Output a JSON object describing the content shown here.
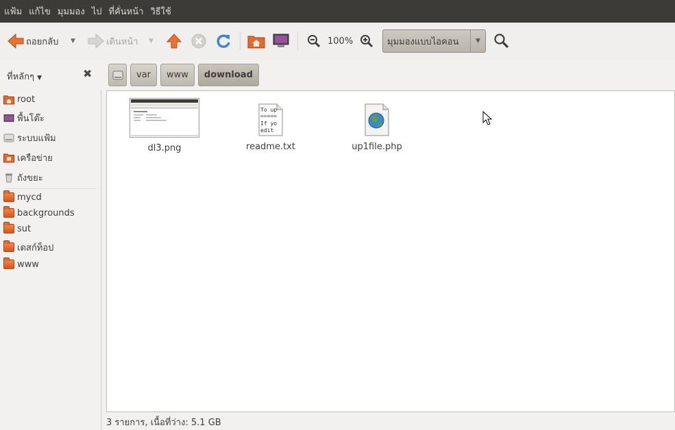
{
  "menubar": {
    "items": [
      "แฟ้ม",
      "แก้ไข",
      "มุมมอง",
      "ไป",
      "ที่คั่นหน้า",
      "วิธีใช้"
    ]
  },
  "toolbar": {
    "back_label": "ถอยกลับ",
    "forward_label": "เดินหน้า",
    "zoom_level": "100%",
    "view_mode": "มุมมองแบบไอคอน"
  },
  "sidebar": {
    "title": "ที่หลักๆ",
    "places": [
      {
        "label": "root",
        "icon": "home-folder-icon"
      },
      {
        "label": "พื้นโต๊ะ",
        "icon": "desktop-icon"
      },
      {
        "label": "ระบบแฟ้ม",
        "icon": "filesystem-drive-icon"
      },
      {
        "label": "เครือข่าย",
        "icon": "network-icon"
      },
      {
        "label": "ถังขยะ",
        "icon": "trash-icon"
      }
    ],
    "bookmarks": [
      {
        "label": "mycd",
        "icon": "folder-icon"
      },
      {
        "label": "backgrounds",
        "icon": "folder-icon"
      },
      {
        "label": "sut",
        "icon": "folder-icon"
      },
      {
        "label": "เดสก์ท็อป",
        "icon": "folder-icon"
      },
      {
        "label": "www",
        "icon": "folder-icon"
      }
    ]
  },
  "pathbar": {
    "crumbs": [
      "var",
      "www",
      "download"
    ]
  },
  "files": [
    {
      "name": "dl3.png",
      "type": "image-thumbnail"
    },
    {
      "name": "readme.txt",
      "type": "text",
      "preview": [
        "To up",
        "=====",
        "If yo",
        "edit"
      ]
    },
    {
      "name": "up1file.php",
      "type": "php-script"
    }
  ],
  "status": {
    "text": "3 รายการ, เนื้อที่ว่าง: 5.1 GB"
  },
  "colors": {
    "menubar_bg": "#3c3b37",
    "accent_orange": "#e26a2e",
    "refresh_blue": "#3d86d0"
  }
}
